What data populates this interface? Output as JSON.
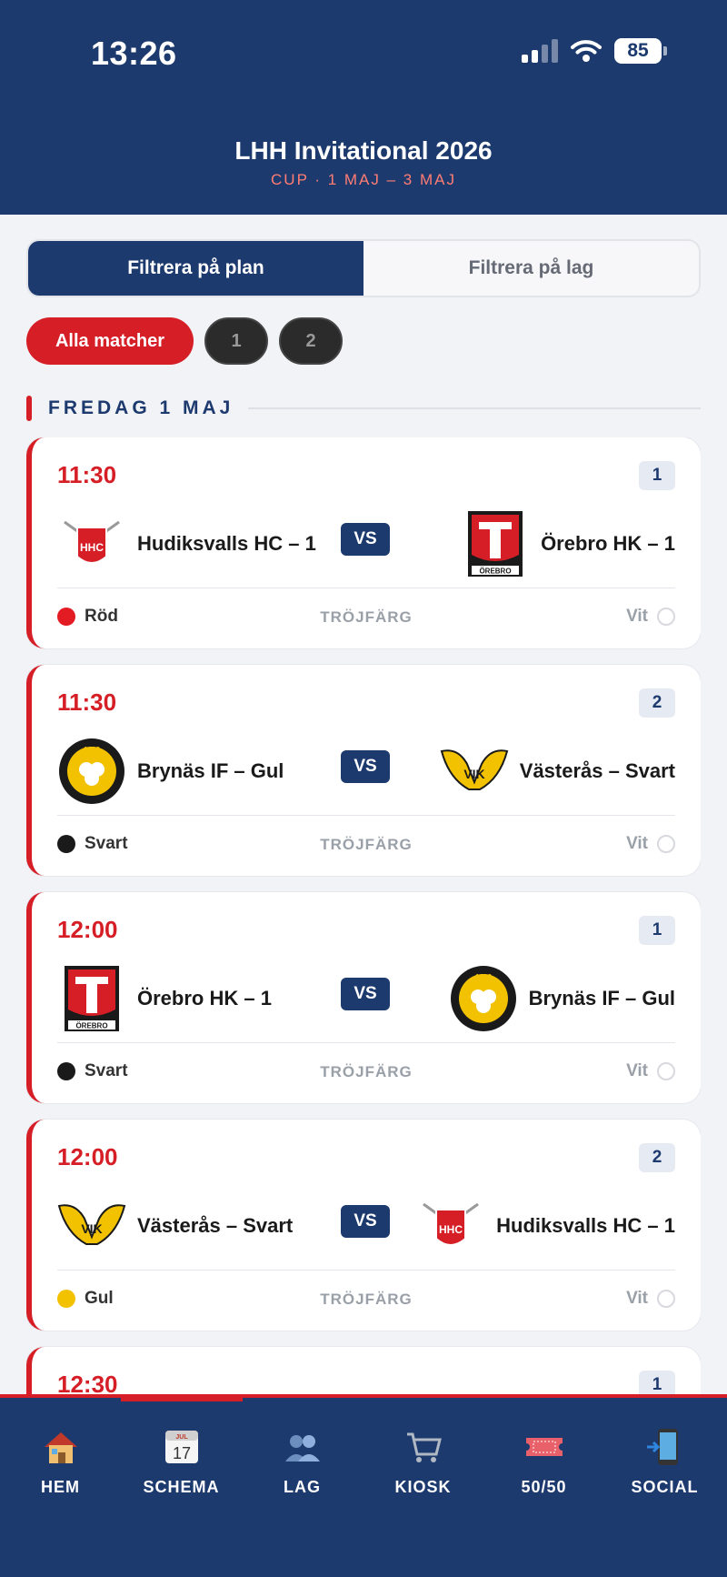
{
  "status_bar": {
    "time": "13:26",
    "battery": "85"
  },
  "header": {
    "title": "LHH Invitational 2026",
    "subtitle": "CUP · 1 MAJ – 3 MAJ"
  },
  "filter_tabs": [
    {
      "label": "Filtrera på plan",
      "active": true
    },
    {
      "label": "Filtrera på lag",
      "active": false
    }
  ],
  "chips": [
    {
      "label": "Alla matcher",
      "active": true
    },
    {
      "label": "1",
      "active": false
    },
    {
      "label": "2",
      "active": false
    }
  ],
  "day_header": "FREDAG 1 MAJ",
  "vs_label": "VS",
  "kit_label": "TRÖJFÄRG",
  "matches": [
    {
      "time": "11:30",
      "field": "1",
      "home": "Hudiksvalls HC – 1",
      "home_logo": "hhc-logo-icon",
      "away": "Örebro HK – 1",
      "away_logo": "orebro-logo-icon",
      "home_kit": "Röd",
      "home_kit_color": "#e31b23",
      "away_kit": "Vit"
    },
    {
      "time": "11:30",
      "field": "2",
      "home": "Brynäs IF – Gul",
      "home_logo": "brynas-logo-icon",
      "away": "Västerås – Svart",
      "away_logo": "vik-logo-icon",
      "home_kit": "Svart",
      "home_kit_color": "#1a1a1a",
      "away_kit": "Vit"
    },
    {
      "time": "12:00",
      "field": "1",
      "home": "Örebro HK – 1",
      "home_logo": "orebro-logo-icon",
      "away": "Brynäs IF – Gul",
      "away_logo": "brynas-logo-icon",
      "home_kit": "Svart",
      "home_kit_color": "#1a1a1a",
      "away_kit": "Vit"
    },
    {
      "time": "12:00",
      "field": "2",
      "home": "Västerås – Svart",
      "home_logo": "vik-logo-icon",
      "away": "Hudiksvalls HC – 1",
      "away_logo": "hhc-logo-icon",
      "home_kit": "Gul",
      "home_kit_color": "#f2c200",
      "away_kit": "Vit"
    },
    {
      "time": "12:30",
      "field": "1"
    }
  ],
  "nav": [
    {
      "label": "HEM",
      "icon": "house-icon"
    },
    {
      "label": "SCHEMA",
      "icon": "calendar-icon",
      "active": true
    },
    {
      "label": "LAG",
      "icon": "people-icon"
    },
    {
      "label": "KIOSK",
      "icon": "cart-icon"
    },
    {
      "label": "50/50",
      "icon": "ticket-icon"
    },
    {
      "label": "SOCIAL",
      "icon": "phone-icon"
    }
  ],
  "colors": {
    "navy": "#1d3a6e",
    "red": "#d61e26",
    "background": "#f2f3f7"
  }
}
